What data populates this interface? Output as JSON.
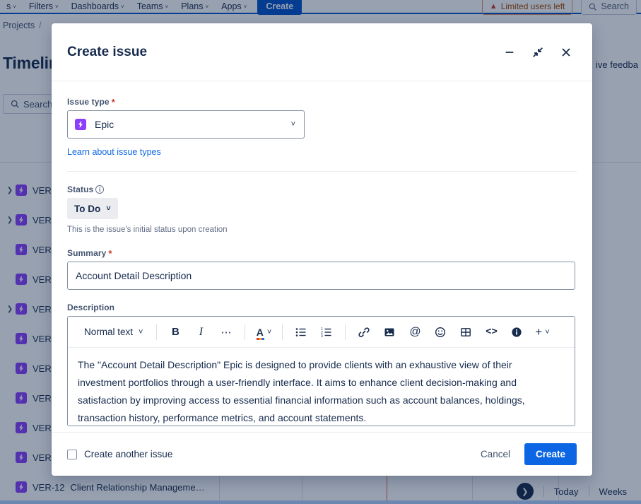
{
  "topnav": {
    "items": [
      {
        "label": "s",
        "caret": "˅"
      },
      {
        "label": "Filters",
        "caret": "˅"
      },
      {
        "label": "Dashboards",
        "caret": "˅"
      },
      {
        "label": "Teams",
        "caret": "˅"
      },
      {
        "label": "Plans",
        "caret": "˅"
      },
      {
        "label": "Apps",
        "caret": "˅"
      }
    ],
    "create_label": "Create",
    "limited_users_label": "Limited users left",
    "warning_icon": "warning-triangle-icon",
    "search_label": "Search",
    "search_icon": "search-icon"
  },
  "background": {
    "breadcrumb": {
      "project": "Projects",
      "separator": "/"
    },
    "page_title": "Timelin",
    "give_feedback": "ive feedba",
    "search_placeholder": "Search",
    "search_icon": "search-icon",
    "rows": [
      {
        "twisty": true,
        "indent": false,
        "key": "VER",
        "summary": "",
        "progress": true
      },
      {
        "twisty": true,
        "indent": false,
        "key": "VER",
        "summary": "",
        "progress": true
      },
      {
        "twisty": false,
        "indent": true,
        "key": "VER",
        "summary": "",
        "progress": false
      },
      {
        "twisty": false,
        "indent": true,
        "key": "VER",
        "summary": "",
        "progress": false
      },
      {
        "twisty": true,
        "indent": false,
        "key": "VER",
        "summary": "",
        "progress": true
      },
      {
        "twisty": false,
        "indent": true,
        "key": "VER",
        "summary": "",
        "progress": false
      },
      {
        "twisty": false,
        "indent": true,
        "key": "VER",
        "summary": "",
        "progress": false
      },
      {
        "twisty": false,
        "indent": true,
        "key": "VER",
        "summary": "",
        "progress": false
      },
      {
        "twisty": false,
        "indent": true,
        "key": "VER",
        "summary": "",
        "progress": false
      },
      {
        "twisty": false,
        "indent": true,
        "key": "VER",
        "summary": "",
        "progress": false
      },
      {
        "twisty": false,
        "indent": true,
        "key": "VER-12",
        "summary": "Client Relationship Manageme…",
        "progress": false
      }
    ],
    "bottom_controls": {
      "scroll_icon": "chevron-right-circle-icon",
      "today_label": "Today",
      "zoom_label": "Weeks"
    },
    "today_marker_color": "#E2643B"
  },
  "modal": {
    "title": "Create issue",
    "header_actions": [
      {
        "name": "minimize-icon"
      },
      {
        "name": "collapse-icon"
      },
      {
        "name": "close-icon"
      }
    ],
    "issue_type": {
      "label": "Issue type",
      "required_marker": "*",
      "value": "Epic",
      "icon": "epic-icon",
      "icon_color": "#8B3FFD",
      "chevron": "˅",
      "learn_link": "Learn about issue types"
    },
    "status": {
      "label": "Status",
      "info_icon": "info-circle-icon",
      "value": "To Do",
      "chevron": "˅",
      "helper": "This is the issue's initial status upon creation"
    },
    "summary": {
      "label": "Summary",
      "required_marker": "*",
      "value": "Account Detail Description",
      "placeholder": ""
    },
    "description": {
      "label": "Description",
      "toolbar": {
        "style_label": "Normal text",
        "style_chevron": "˅",
        "items": [
          {
            "name": "bold-icon",
            "glyph": "B"
          },
          {
            "name": "italic-icon",
            "glyph": "I"
          },
          {
            "name": "more-formatting-icon",
            "glyph": "…"
          },
          {
            "name": "text-color-icon",
            "glyph": "A"
          },
          {
            "name": "bullet-list-icon",
            "glyph": ""
          },
          {
            "name": "numbered-list-icon",
            "glyph": ""
          },
          {
            "name": "link-icon",
            "glyph": ""
          },
          {
            "name": "image-icon",
            "glyph": ""
          },
          {
            "name": "mention-icon",
            "glyph": "@"
          },
          {
            "name": "emoji-icon",
            "glyph": ""
          },
          {
            "name": "table-icon",
            "glyph": ""
          },
          {
            "name": "code-icon",
            "glyph": "<>"
          },
          {
            "name": "info-panel-icon",
            "glyph": "i"
          },
          {
            "name": "insert-more-icon",
            "glyph": "+"
          }
        ]
      },
      "body_lines": [
        "The \"Account Detail Description\" Epic is designed to provide clients with an exhaustive view of their",
        "investment portfolios through a user-friendly interface. It aims to enhance client decision-making and",
        "satisfaction by improving access to essential financial information such as account balances, holdings,",
        "transaction history, performance metrics, and account statements."
      ]
    },
    "footer": {
      "create_another_label": "Create another issue",
      "create_another_checked": false,
      "cancel_label": "Cancel",
      "create_label": "Create"
    }
  }
}
